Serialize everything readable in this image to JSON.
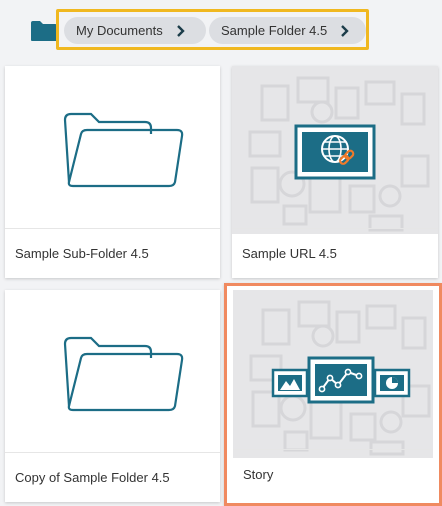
{
  "breadcrumb": {
    "items": [
      {
        "label": "My Documents"
      },
      {
        "label": "Sample Folder 4.5"
      }
    ]
  },
  "cards": [
    {
      "label": "Sample Sub-Folder 4.5",
      "type": "folder"
    },
    {
      "label": "Sample URL 4.5",
      "type": "url"
    },
    {
      "label": "Copy of Sample Folder 4.5",
      "type": "folder"
    },
    {
      "label": "Story",
      "type": "story",
      "selected": true
    }
  ],
  "colors": {
    "accent": "#1c6d86",
    "breadcrumb_highlight": "#f0b820",
    "selection_border": "#f08a60",
    "link_orange": "#f07a2a"
  },
  "icons": [
    "folder-icon",
    "chevron-right-icon",
    "globe-link-icon",
    "story-chart-icon"
  ]
}
